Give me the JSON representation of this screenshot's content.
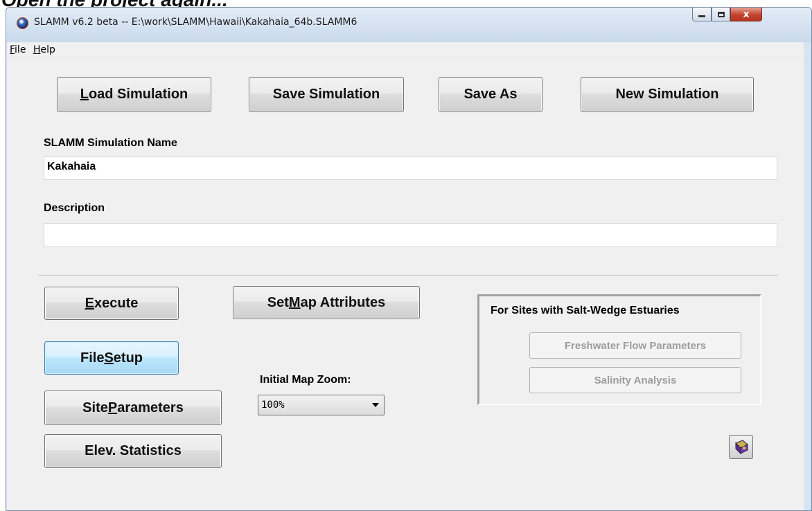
{
  "top_crop_text": "Open the project again...",
  "window": {
    "title": "SLAMM v6.2 beta -- E:\\work\\SLAMM\\Hawaii\\Kakahaia_64b.SLAMM6",
    "close_glyph": "x"
  },
  "menu": {
    "file": {
      "accel": "F",
      "rest": "ile"
    },
    "help": {
      "accel": "H",
      "rest": "elp"
    }
  },
  "toolbar": {
    "load": {
      "accel": "L",
      "rest": "oad Simulation"
    },
    "save": "Save Simulation",
    "save_as": "Save As",
    "new": "New Simulation"
  },
  "fields": {
    "name_label": "SLAMM Simulation Name",
    "name_value": "Kakahaia",
    "description_label": "Description",
    "description_value": ""
  },
  "actions": {
    "execute": {
      "accel": "E",
      "rest": "xecute"
    },
    "set_map": {
      "pre": "Set ",
      "accel": "M",
      "rest": "ap Attributes"
    },
    "file_setup": {
      "pre": "File ",
      "accel": "S",
      "rest": "etup"
    },
    "site_params": {
      "pre": "Site ",
      "accel": "P",
      "rest": "arameters"
    },
    "elev_stats": "Elev. Statistics"
  },
  "zoom": {
    "label": "Initial Map Zoom:",
    "selected": "100%"
  },
  "estuary": {
    "title": "For Sites with Salt-Wedge Estuaries",
    "freshwater": "Freshwater Flow Parameters",
    "salinity": "Salinity Analysis"
  },
  "icons": {
    "app": "globe-icon",
    "help": "help-book-icon"
  },
  "colors": {
    "client_bg": "#f0f0f0",
    "focus_button": "#bee6fd",
    "close_button": "#c2432d"
  }
}
